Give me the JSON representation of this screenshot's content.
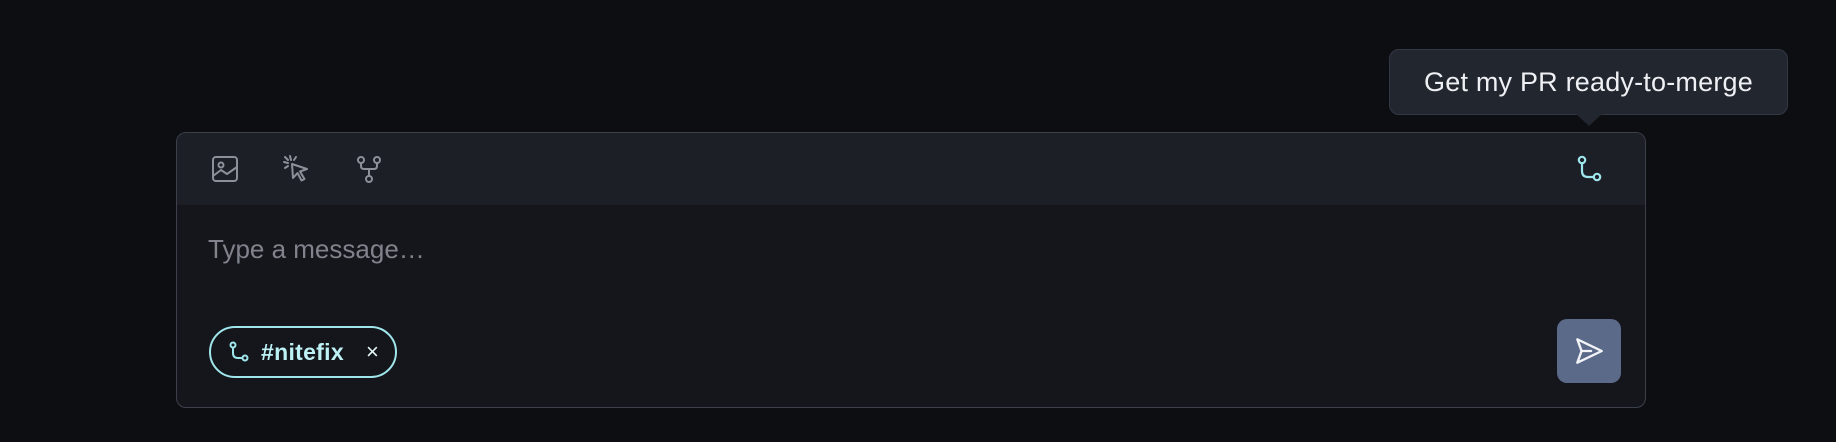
{
  "tooltip": {
    "text": "Get my PR ready-to-merge"
  },
  "toolbar": {
    "buttons": [
      {
        "icon": "image-icon"
      },
      {
        "icon": "cursor-click-icon"
      },
      {
        "icon": "fork-icon"
      }
    ],
    "right_button": {
      "icon": "git-pull-request-icon",
      "color": "#9fe6ec"
    }
  },
  "composer": {
    "placeholder": "Type a message…",
    "value": ""
  },
  "chip": {
    "icon": "git-branch-icon",
    "label": "#nitefix",
    "remove": "×",
    "color": "#9fe6ec"
  },
  "send": {
    "icon": "send-icon",
    "background": "#5c6a8a"
  }
}
